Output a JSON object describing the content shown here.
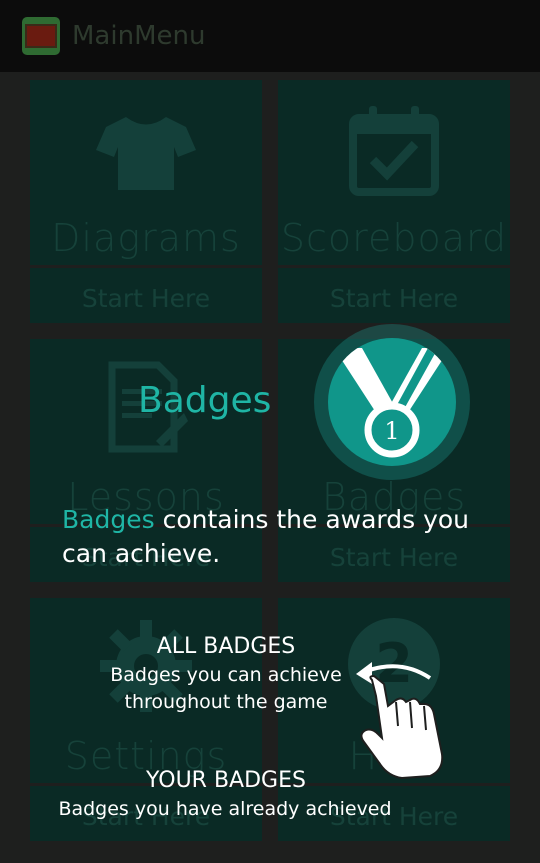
{
  "app": {
    "title": "MainMenu"
  },
  "tiles": [
    {
      "label": "Diagrams",
      "action": "Start Here",
      "icon": "shirt-icon"
    },
    {
      "label": "Scoreboard",
      "action": "Start Here",
      "icon": "calendar-check-icon"
    },
    {
      "label": "Lessons",
      "action": "Start Here",
      "icon": "document-edit-icon"
    },
    {
      "label": "Badges",
      "action": "Start Here",
      "icon": "medal-icon"
    },
    {
      "label": "Settings",
      "action": "Start Here",
      "icon": "gear-icon"
    },
    {
      "label": "Help",
      "action": "Start Here",
      "icon": "help-icon"
    }
  ],
  "coachmark": {
    "title": "Badges",
    "highlight_word": "Badges",
    "body": "contains the awards you can achieve.",
    "medal_number": "1",
    "sections": [
      {
        "title": "ALL BADGES",
        "description_line1": "Badges you can achieve",
        "description_line2": "throughout the game"
      },
      {
        "title": "YOUR BADGES",
        "description_line1": "Badges you have already achieved"
      }
    ]
  },
  "colors": {
    "accent": "#1fb5a5",
    "tile": "#0a2a25",
    "background": "#1e1f1e"
  }
}
